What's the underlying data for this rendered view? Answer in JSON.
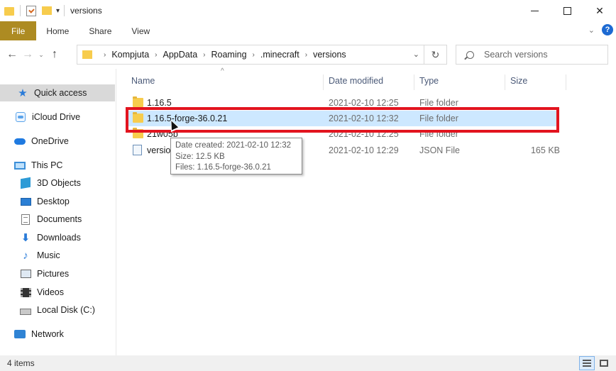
{
  "window": {
    "title": "versions",
    "minimize_icon": "minimize-icon",
    "maximize_icon": "maximize-icon",
    "close_glyph": "✕"
  },
  "ribbon": {
    "tabs": [
      "File",
      "Home",
      "Share",
      "View"
    ],
    "collapse_glyph": "⌄",
    "help_glyph": "?",
    "file_tab_color": "#ad8b22"
  },
  "nav": {
    "back_glyph": "←",
    "forward_glyph": "→",
    "recent_glyph": "⌄",
    "up_glyph": "↑",
    "breadcrumbs": [
      "Kompjuta",
      "AppData",
      "Roaming",
      ".minecraft",
      "versions"
    ],
    "crumb_separator": "›",
    "dropdown_glyph": "⌄",
    "refresh_glyph": "↻"
  },
  "search": {
    "placeholder": "Search versions"
  },
  "sidebar": {
    "items": [
      {
        "label": "Quick access",
        "icon": "star-icon",
        "selected": true
      },
      {
        "label": "iCloud Drive",
        "icon": "icloud-drive-icon"
      },
      {
        "label": "OneDrive",
        "icon": "onedrive-cloud-icon"
      },
      {
        "label": "This PC",
        "icon": "computer-icon"
      },
      {
        "label": "3D Objects",
        "icon": "cube-icon"
      },
      {
        "label": "Desktop",
        "icon": "desktop-icon"
      },
      {
        "label": "Documents",
        "icon": "document-icon"
      },
      {
        "label": "Downloads",
        "icon": "download-arrow-icon"
      },
      {
        "label": "Music",
        "icon": "music-note-icon"
      },
      {
        "label": "Pictures",
        "icon": "pictures-icon"
      },
      {
        "label": "Videos",
        "icon": "film-strip-icon"
      },
      {
        "label": "Local Disk (C:)",
        "icon": "disk-drive-icon"
      },
      {
        "label": "Network",
        "icon": "network-icon"
      }
    ]
  },
  "columns": {
    "name": "Name",
    "date": "Date modified",
    "type": "Type",
    "size": "Size",
    "sort_glyph": "^"
  },
  "files": [
    {
      "name": "1.16.5",
      "date": "2021-02-10 12:25",
      "type": "File folder",
      "size": "",
      "icon": "folder-icon"
    },
    {
      "name": "1.16.5-forge-36.0.21",
      "date": "2021-02-10 12:32",
      "type": "File folder",
      "size": "",
      "icon": "folder-icon",
      "selected": true
    },
    {
      "name": "21w05b",
      "date": "2021-02-10 12:25",
      "type": "File folder",
      "size": "",
      "icon": "folder-icon"
    },
    {
      "name": "versio",
      "date": "2021-02-10 12:29",
      "type": "JSON File",
      "size": "165 KB",
      "icon": "json-file-icon"
    }
  ],
  "tooltip": {
    "created": "Date created: 2021-02-10 12:32",
    "size": "Size: 12.5 KB",
    "files": "Files: 1.16.5-forge-36.0.21"
  },
  "status": {
    "item_count": "4 items"
  },
  "colors": {
    "selection": "#cde8ff",
    "highlight_box": "#e2141f",
    "folder": "#f7cc4d"
  }
}
